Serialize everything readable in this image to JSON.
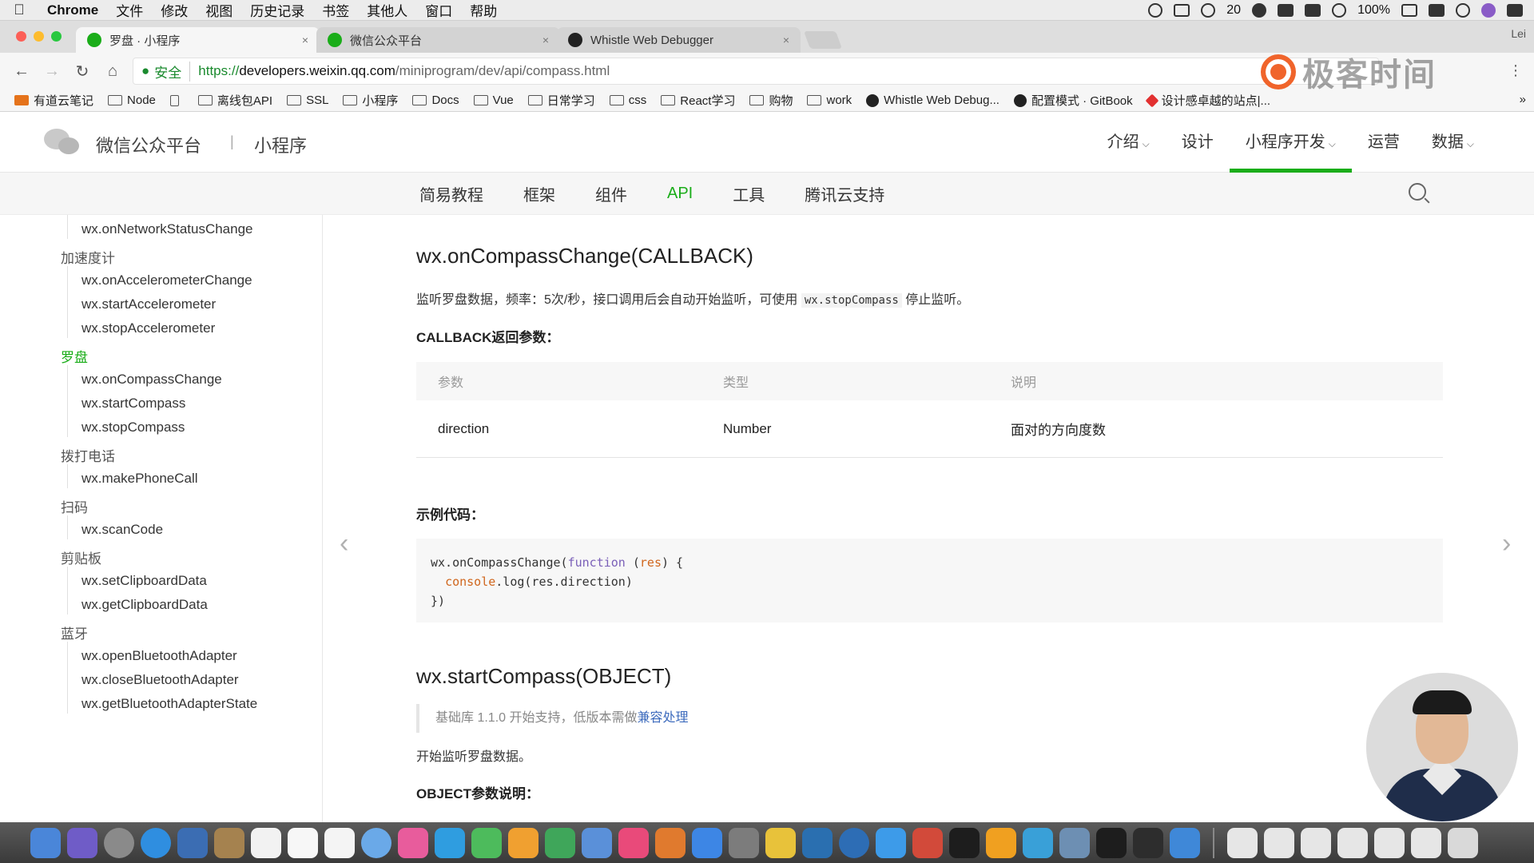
{
  "menubar": {
    "apple": "",
    "items": [
      "Chrome",
      "文件",
      "修改",
      "视图",
      "历史记录",
      "书签",
      "其他人",
      "窗口",
      "帮助"
    ],
    "status_count": "20",
    "battery": "100%"
  },
  "tabs": [
    {
      "title": "罗盘 · 小程序",
      "close": "×",
      "color": "#1aad19"
    },
    {
      "title": "微信公众平台",
      "close": "×",
      "color": "#1aad19"
    },
    {
      "title": "Whistle Web Debugger",
      "close": "×",
      "color": "#222222"
    }
  ],
  "tab_user": "Lei",
  "toolbar": {
    "back": "←",
    "forward": "→",
    "reload": "↻",
    "home": "⌂",
    "secure_label": "安全",
    "url_scheme": "https://",
    "url_host": "developers.weixin.qq.com",
    "url_path": "/miniprogram/dev/api/compass.html",
    "brand_text": "极客时间",
    "menu": "⋮"
  },
  "bookmarks": [
    {
      "label": "有道云笔记",
      "icon": "filled"
    },
    {
      "label": "Node",
      "icon": "folder"
    },
    {
      "label": "",
      "icon": "page"
    },
    {
      "label": "离线包API",
      "icon": "folder"
    },
    {
      "label": "SSL",
      "icon": "folder"
    },
    {
      "label": "小程序",
      "icon": "folder"
    },
    {
      "label": "Docs",
      "icon": "folder"
    },
    {
      "label": "Vue",
      "icon": "folder"
    },
    {
      "label": "日常学习",
      "icon": "folder"
    },
    {
      "label": "css",
      "icon": "folder"
    },
    {
      "label": "React学习",
      "icon": "folder"
    },
    {
      "label": "购物",
      "icon": "folder"
    },
    {
      "label": "work",
      "icon": "folder"
    },
    {
      "label": "Whistle Web Debug...",
      "icon": "w"
    },
    {
      "label": "配置模式 · GitBook",
      "icon": "w"
    },
    {
      "label": "设计感卓越的站点|...",
      "icon": "heart"
    }
  ],
  "bookmarks_more": "»",
  "site": {
    "name": "微信公众平台",
    "sep": "|",
    "sub": "小程序",
    "nav": [
      {
        "label": "介绍",
        "caret": "⌵"
      },
      {
        "label": "设计",
        "caret": ""
      },
      {
        "label": "小程序开发",
        "caret": "⌵"
      },
      {
        "label": "运营",
        "caret": ""
      },
      {
        "label": "数据",
        "caret": "⌵"
      }
    ]
  },
  "subnav": [
    "简易教程",
    "框架",
    "组件",
    "API",
    "工具",
    "腾讯云支持"
  ],
  "sidebar": {
    "entries": [
      {
        "type": "it",
        "label": "wx.onNetworkStatusChange"
      },
      {
        "type": "grp",
        "label": "加速度计"
      },
      {
        "type": "it",
        "label": "wx.onAccelerometerChange"
      },
      {
        "type": "it",
        "label": "wx.startAccelerometer"
      },
      {
        "type": "it",
        "label": "wx.stopAccelerometer"
      },
      {
        "type": "grp",
        "label": "罗盘",
        "active": true
      },
      {
        "type": "it",
        "label": "wx.onCompassChange"
      },
      {
        "type": "it",
        "label": "wx.startCompass"
      },
      {
        "type": "it",
        "label": "wx.stopCompass"
      },
      {
        "type": "grp",
        "label": "拨打电话"
      },
      {
        "type": "it",
        "label": "wx.makePhoneCall"
      },
      {
        "type": "grp",
        "label": "扫码"
      },
      {
        "type": "it",
        "label": "wx.scanCode"
      },
      {
        "type": "grp",
        "label": "剪贴板"
      },
      {
        "type": "it",
        "label": "wx.setClipboardData"
      },
      {
        "type": "it",
        "label": "wx.getClipboardData"
      },
      {
        "type": "grp",
        "label": "蓝牙"
      },
      {
        "type": "it",
        "label": "wx.openBluetoothAdapter"
      },
      {
        "type": "it",
        "label": "wx.closeBluetoothAdapter"
      },
      {
        "type": "it",
        "label": "wx.getBluetoothAdapterState"
      }
    ]
  },
  "main": {
    "h1": "wx.onCompassChange(CALLBACK)",
    "desc_pre": "监听罗盘数据，频率：5次/秒，接口调用后会自动开始监听，可使用",
    "desc_code": "wx.stopCompass",
    "desc_post": "停止监听。",
    "callback_title": "CALLBACK返回参数：",
    "table_headers": [
      "参数",
      "类型",
      "说明"
    ],
    "table_rows": [
      [
        "direction",
        "Number",
        "面对的方向度数"
      ]
    ],
    "example_title": "示例代码：",
    "code": {
      "l1_a": "wx.onCompassChange(",
      "l1_kw": "function",
      "l1_sp": " (",
      "l1_arg": "res",
      "l1_b": ") {",
      "l2_indent": "  ",
      "l2_obj": "console",
      "l2_rest": ".log(res.direction)",
      "l3": "})"
    },
    "h2": "wx.startCompass(OBJECT)",
    "note_text": "基础库 1.1.0 开始支持，低版本需做",
    "note_link": "兼容处理",
    "start_desc": "开始监听罗盘数据。",
    "object_title": "OBJECT参数说明：",
    "prev": "‹",
    "next": "›"
  },
  "dock_colors": [
    "#4a86d9",
    "#6f5cc7",
    "#8a8a8a",
    "#2f8ee0",
    "#3b6db3",
    "#a5824f",
    "#f2f2f2",
    "#f7f7f7",
    "#f4f4f4",
    "#6aa9e8",
    "#e85c9c",
    "#2f9de0",
    "#4dbb5c",
    "#f0a030",
    "#3fa65a",
    "#5a90d9",
    "#e94a7a",
    "#e07a2e",
    "#3d86e5",
    "#7c7c7c",
    "#e8c23a",
    "#2a6fb0",
    "#2d6db5",
    "#3d9be9",
    "#d24a3a",
    "#1d1d1d",
    "#f0a020",
    "#39a0d8",
    "#6d8fb3",
    "#1d1d1d",
    "#2d2d2d",
    "#3f88d8",
    "#e6e6e6",
    "#e6e6e6",
    "#e6e6e6",
    "#e6e6e6",
    "#e6e6e6",
    "#e6e6e6",
    "#d9d9d9"
  ],
  "colors": {
    "accent_green": "#1aad19",
    "link_blue": "#3d6bbd"
  }
}
